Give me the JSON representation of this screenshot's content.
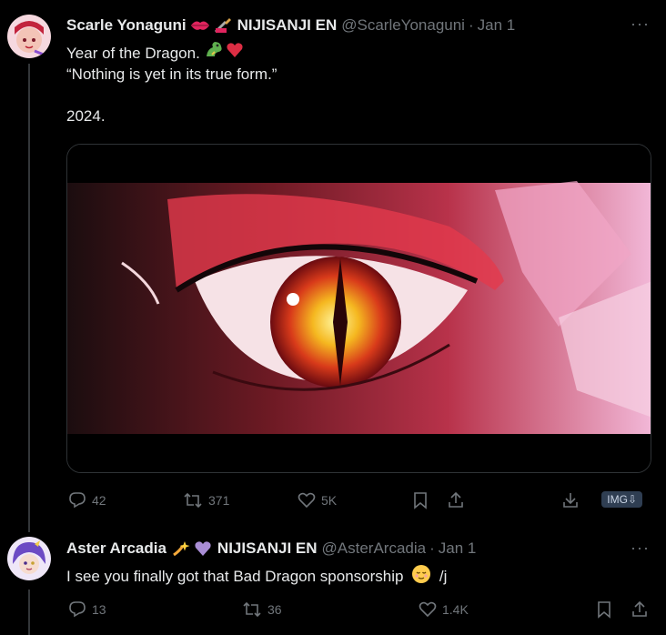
{
  "tweets": [
    {
      "name": "Scarle Yonaguni",
      "affiliation": "NIJISANJI EN",
      "handle": "@ScarleYonaguni",
      "date": "Jan 1",
      "text_line1": "Year of the Dragon.",
      "text_line2": "“Nothing is yet in its true form.”",
      "text_line3": "2024.",
      "stats": {
        "replies": "42",
        "reposts": "371",
        "likes": "5K"
      },
      "img_badge": "IMG⇩"
    },
    {
      "name": "Aster Arcadia",
      "affiliation": "NIJISANJI EN",
      "handle": "@AsterArcadia",
      "date": "Jan 1",
      "text": "I see you finally got that Bad Dragon sponsorship",
      "text_suffix": "/j",
      "stats": {
        "replies": "13",
        "reposts": "36",
        "likes": "1.4K"
      }
    }
  ],
  "icons": [
    "more-icon",
    "reply-icon",
    "repost-icon",
    "like-icon",
    "bookmark-icon",
    "share-icon",
    "download-icon",
    "lips-emoji",
    "brush-emoji",
    "dragon-emoji",
    "heart-emoji",
    "sparkle-star-emoji",
    "purple-heart-emoji",
    "relieved-face-emoji"
  ],
  "colors": {
    "background": "#000000",
    "text": "#e7e9ea",
    "muted": "#71767b",
    "border": "#2f3336"
  }
}
